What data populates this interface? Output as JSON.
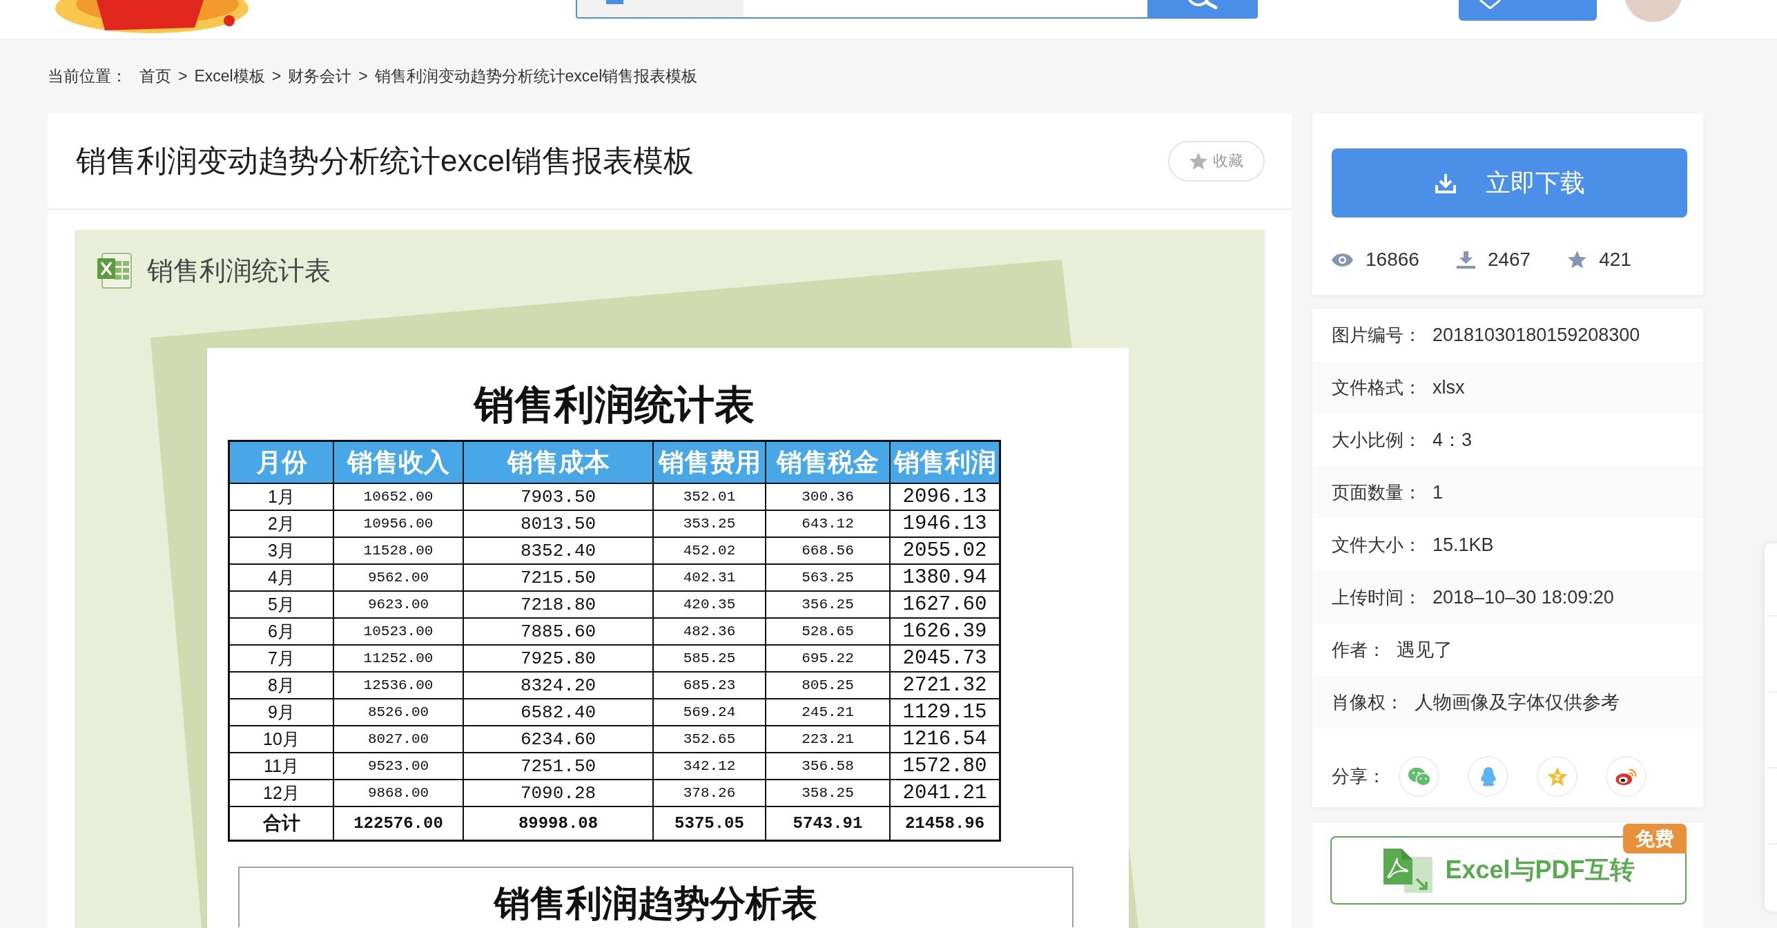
{
  "breadcrumb": {
    "label": "当前位置：",
    "crumbs": [
      "首页",
      "Excel模板",
      "财务会计",
      "销售利润变动趋势分析统计excel销售报表模板"
    ],
    "separators": [
      ">",
      ">",
      ">"
    ]
  },
  "title": "销售利润变动趋势分析统计excel销售报表模板",
  "favorite_button": {
    "label": "收藏"
  },
  "preview": {
    "caption": "销售利润统计表",
    "sheet_title": "销售利润统计表",
    "columns": [
      "月份",
      "销售收入",
      "销售成本",
      "销售费用",
      "销售税金",
      "销售利润"
    ],
    "rows": [
      {
        "kind": "data",
        "cells": [
          "1月",
          "10652.00",
          "7903.50",
          "352.01",
          "300.36",
          "2096.13"
        ]
      },
      {
        "kind": "data",
        "cells": [
          "2月",
          "10956.00",
          "8013.50",
          "353.25",
          "643.12",
          "1946.13"
        ]
      },
      {
        "kind": "data",
        "cells": [
          "3月",
          "11528.00",
          "8352.40",
          "452.02",
          "668.56",
          "2055.02"
        ]
      },
      {
        "kind": "data",
        "cells": [
          "4月",
          "9562.00",
          "7215.50",
          "402.31",
          "563.25",
          "1380.94"
        ]
      },
      {
        "kind": "data",
        "cells": [
          "5月",
          "9623.00",
          "7218.80",
          "420.35",
          "356.25",
          "1627.60"
        ]
      },
      {
        "kind": "data",
        "cells": [
          "6月",
          "10523.00",
          "7885.60",
          "482.36",
          "528.65",
          "1626.39"
        ]
      },
      {
        "kind": "data",
        "cells": [
          "7月",
          "11252.00",
          "7925.80",
          "585.25",
          "695.22",
          "2045.73"
        ]
      },
      {
        "kind": "data",
        "cells": [
          "8月",
          "12536.00",
          "8324.20",
          "685.23",
          "805.25",
          "2721.32"
        ]
      },
      {
        "kind": "data",
        "cells": [
          "9月",
          "8526.00",
          "6582.40",
          "569.24",
          "245.21",
          "1129.15"
        ]
      },
      {
        "kind": "data",
        "cells": [
          "10月",
          "8027.00",
          "6234.60",
          "352.65",
          "223.21",
          "1216.54"
        ]
      },
      {
        "kind": "data",
        "cells": [
          "11月",
          "9523.00",
          "7251.50",
          "342.12",
          "356.58",
          "1572.80"
        ]
      },
      {
        "kind": "data",
        "cells": [
          "12月",
          "9868.00",
          "7090.28",
          "378.26",
          "358.25",
          "2041.21"
        ]
      },
      {
        "kind": "total",
        "cells": [
          "合计",
          "122576.00",
          "89998.08",
          "5375.05",
          "5743.91",
          "21458.96"
        ]
      }
    ],
    "second_sheet_title": "销售利润趋势分析表"
  },
  "download_button": {
    "label": "立即下载"
  },
  "stats": [
    {
      "kind": "views",
      "value": "16866"
    },
    {
      "kind": "downloads",
      "value": "2467"
    },
    {
      "kind": "favorites",
      "value": "421"
    }
  ],
  "details": [
    {
      "label": "图片编号：",
      "value": "20181030180159208300"
    },
    {
      "label": "文件格式：",
      "value": "xlsx"
    },
    {
      "label": "大小比例：",
      "value": "4：3"
    },
    {
      "label": "页面数量：",
      "value": "1"
    },
    {
      "label": "文件大小：",
      "value": "15.1KB"
    },
    {
      "label": "上传时间：",
      "value": "2018–10–30 18:09:20"
    },
    {
      "label": "作者：",
      "value": "遇见了"
    },
    {
      "label": "肖像权：",
      "value": "人物画像及字体仅供参考"
    }
  ],
  "share": {
    "label": "分享：",
    "targets": [
      {
        "kind": "chat"
      },
      {
        "kind": "penguin"
      },
      {
        "kind": "zone"
      },
      {
        "kind": "swirl"
      }
    ]
  },
  "convert_button": {
    "label": "Excel与PDF互转",
    "badge": "免费"
  }
}
